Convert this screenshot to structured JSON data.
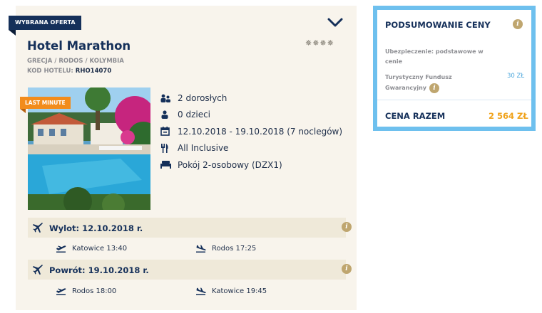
{
  "offer": {
    "ribbon": "WYBRANA OFERTA",
    "hotel_name": "Hotel Marathon",
    "stars": "✵✵✵✵",
    "location": "GRECJA / RODOS / KOLYMBIA",
    "code_label": "KOD HOTELU:",
    "code_value": "RHO14070",
    "badge": "LAST MINUTE",
    "details": {
      "adults": "2 dorosłych",
      "children": "0 dzieci",
      "dates": "12.10.2018 - 19.10.2018 (7 noclegów)",
      "board": "All Inclusive",
      "room": "Pokój 2-osobowy (DZX1)"
    }
  },
  "flights": {
    "outbound": {
      "label": "Wylot: 12.10.2018 r.",
      "departure": "Katowice 13:40",
      "arrival": "Rodos 17:25"
    },
    "return": {
      "label": "Powrót: 19.10.2018 r.",
      "departure": "Rodos 18:00",
      "arrival": "Katowice 19:45"
    }
  },
  "summary": {
    "title": "PODSUMOWANIE CENY",
    "insurance": "Ubezpieczenie: podstawowe w cenie",
    "tfg_label": "Turystyczny Fundusz Gwarancyjny",
    "tfg_value": "30 ZŁ",
    "total_label": "CENA RAZEM",
    "total_value": "2 564 ZŁ"
  },
  "colors": {
    "navy": "#15305a",
    "accent_orange": "#f28c1c",
    "price_orange": "#f0a21a",
    "summary_border": "#6ec0ee",
    "info_gold": "#bfa66f"
  },
  "icons": {
    "collapse": "chevron-down-icon",
    "info": "info-icon",
    "people": "people-icon",
    "person": "person-icon",
    "calendar": "calendar-icon",
    "board": "fork-knife-icon",
    "room": "bed-icon",
    "plane": "plane-icon",
    "takeoff": "takeoff-icon",
    "landing": "landing-icon"
  }
}
